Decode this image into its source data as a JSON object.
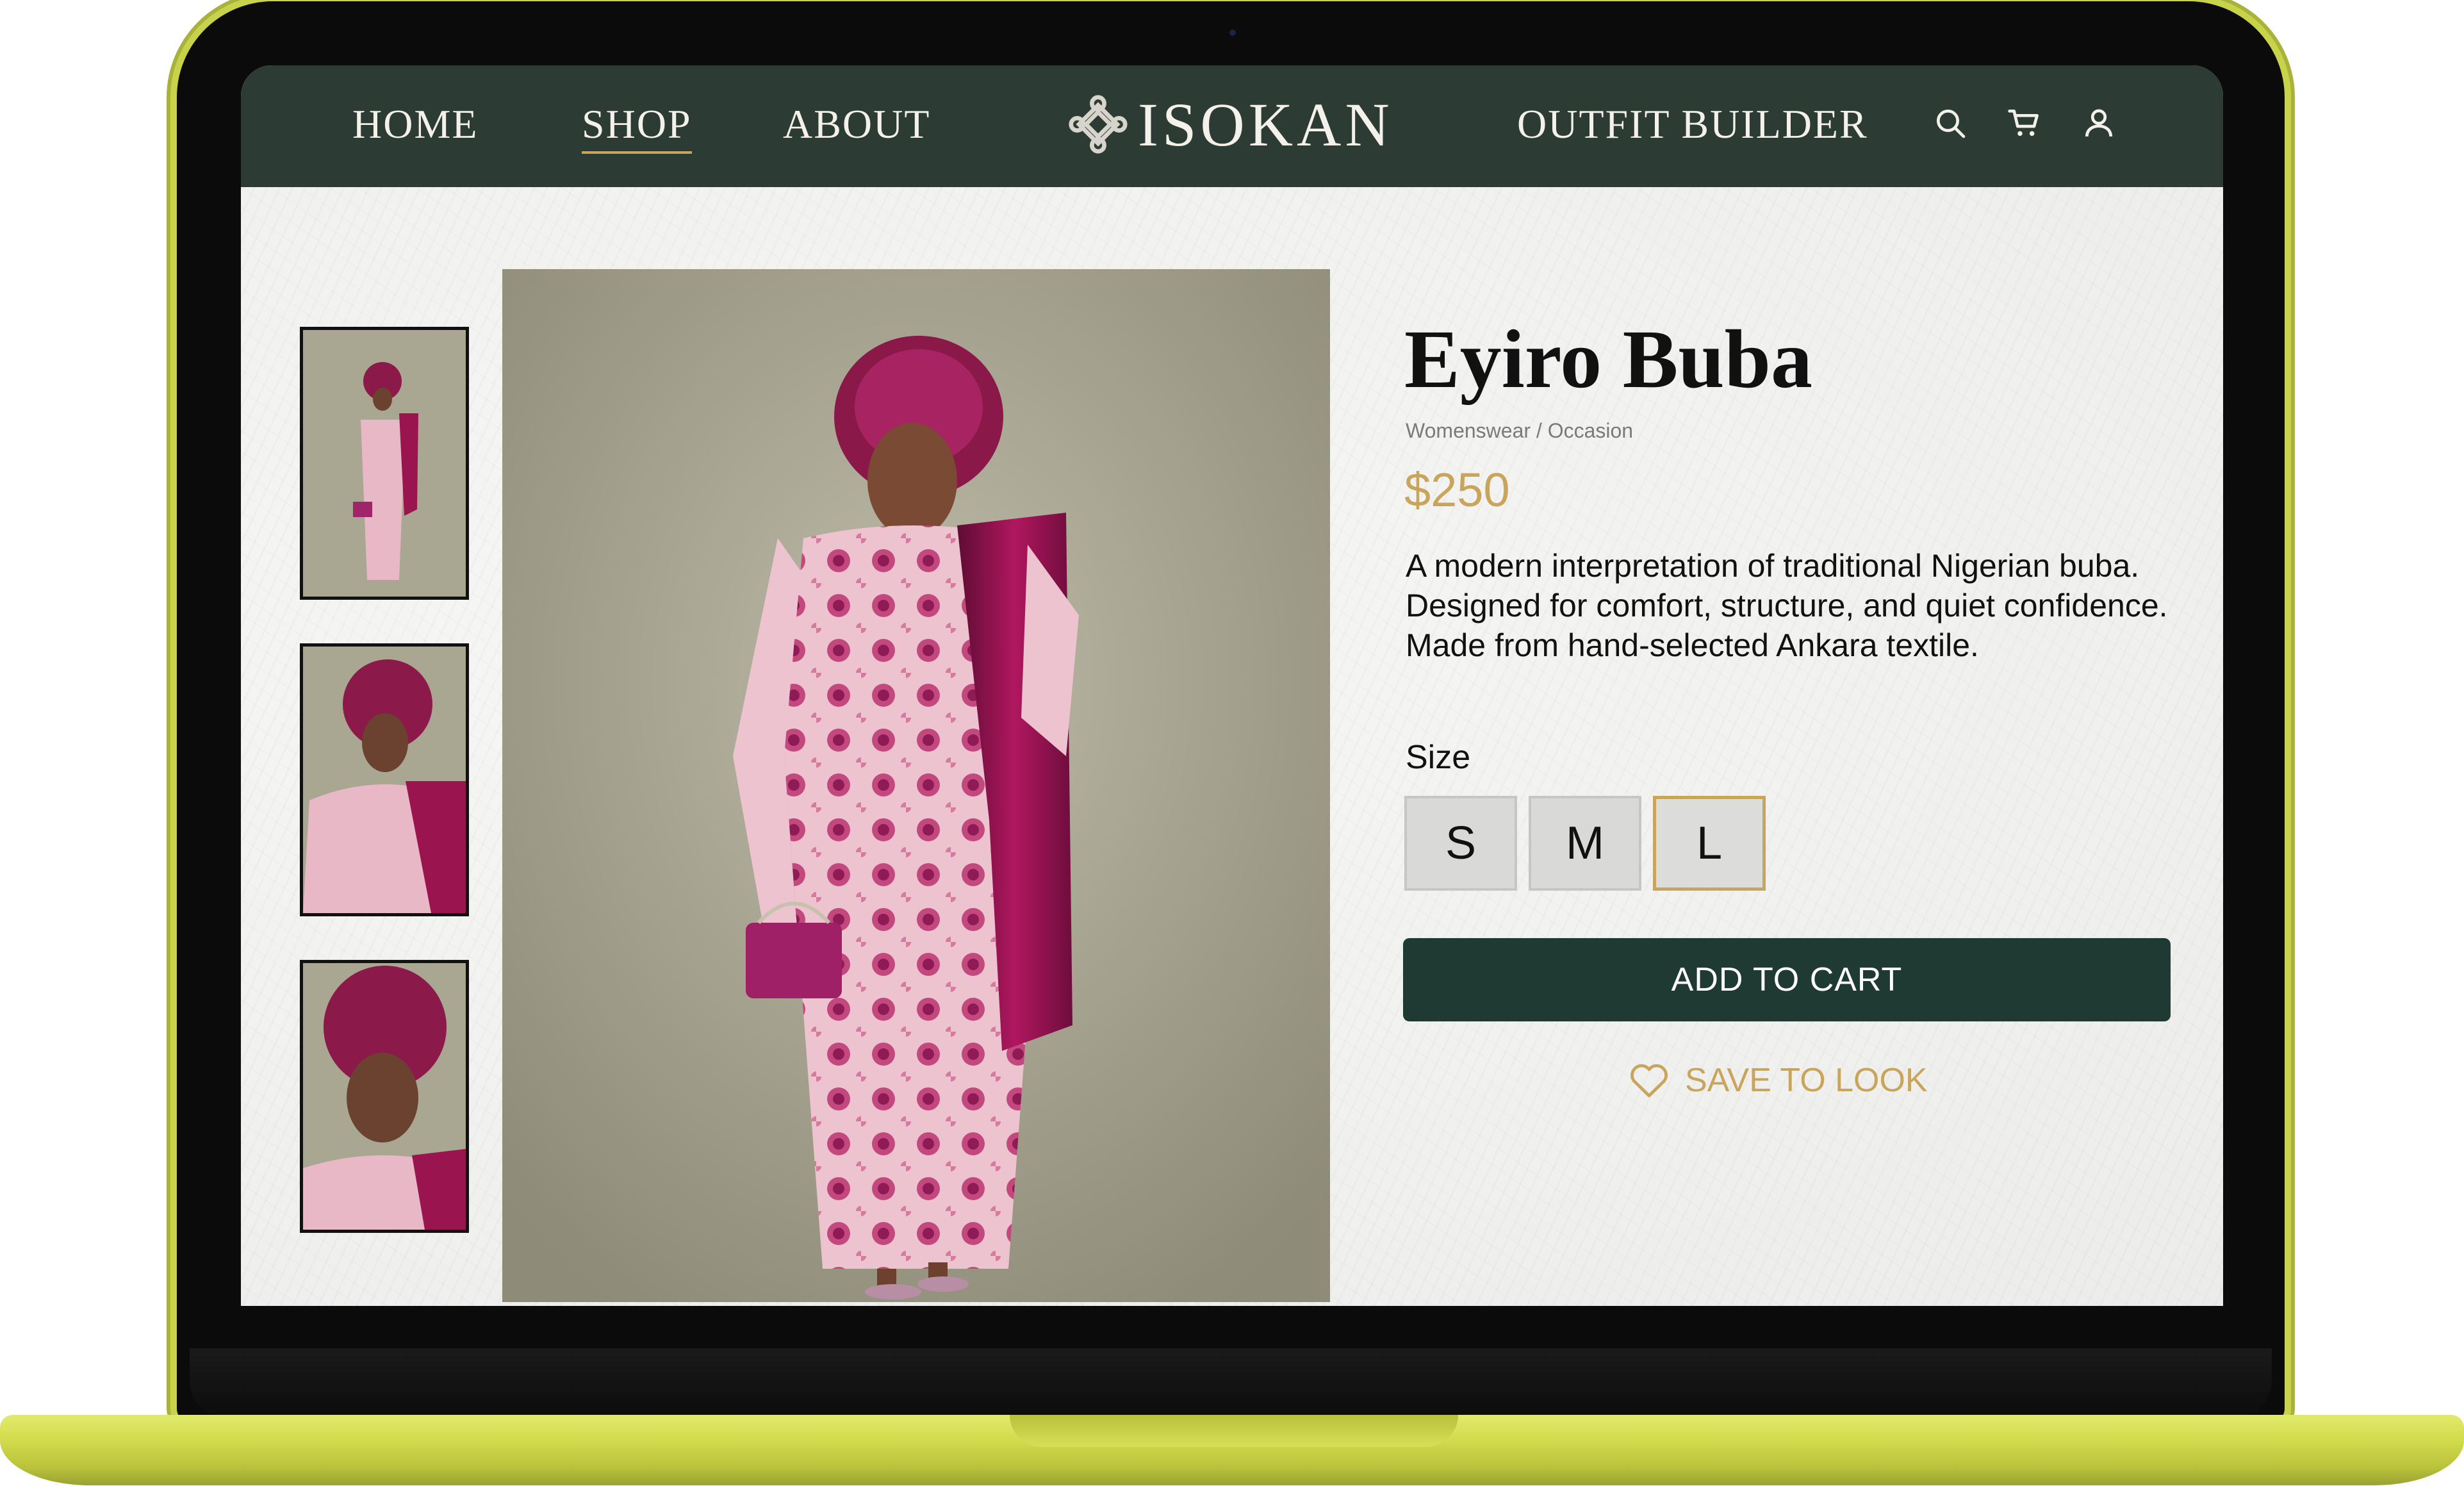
{
  "nav": {
    "links": [
      "HOME",
      "SHOP",
      "ABOUT",
      "OUTFIT BUILDER"
    ],
    "active": "SHOP",
    "brand": "ISOKAN"
  },
  "product": {
    "name": "Eyiro Buba",
    "category": "Womenswear / Occasion",
    "price": "$250",
    "description": [
      "A modern interpretation of traditional Nigerian buba.",
      "Designed for comfort, structure, and quiet confidence.",
      "Made from hand-selected Ankara textile."
    ],
    "size_label": "Size",
    "sizes": [
      "S",
      "M",
      "L"
    ],
    "selected_size": "L",
    "add_to_cart": "ADD TO CART",
    "save_to_look": "SAVE TO LOOK"
  },
  "icons": [
    "search-icon",
    "cart-icon",
    "user-icon",
    "heart-icon",
    "knot-logo-icon"
  ],
  "colors": {
    "nav_bg": "#2c3b33",
    "accent_gold": "#c9a55c",
    "button_green": "#1f3a32",
    "laptop_body": "#d3dc4c"
  }
}
